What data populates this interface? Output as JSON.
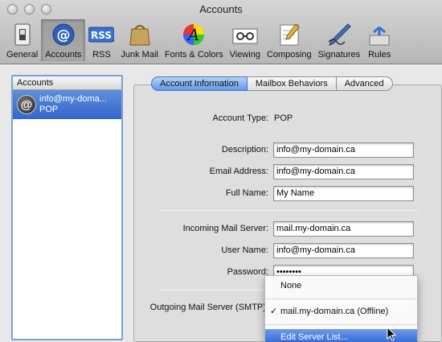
{
  "window": {
    "title": "Accounts"
  },
  "toolbar": {
    "items": [
      {
        "label": "General",
        "icon": "general-switch-icon"
      },
      {
        "label": "Accounts",
        "icon": "at-sign-icon"
      },
      {
        "label": "RSS",
        "icon": "rss-icon"
      },
      {
        "label": "Junk Mail",
        "icon": "junk-mail-bag-icon"
      },
      {
        "label": "Fonts & Colors",
        "icon": "fonts-colors-icon"
      },
      {
        "label": "Viewing",
        "icon": "viewing-icon"
      },
      {
        "label": "Composing",
        "icon": "composing-icon"
      },
      {
        "label": "Signatures",
        "icon": "signature-pen-icon"
      },
      {
        "label": "Rules",
        "icon": "rules-icon"
      }
    ],
    "selected": "Accounts"
  },
  "accounts_list": {
    "header": "Accounts",
    "items": [
      {
        "name": "info@my-doma...",
        "type": "POP"
      }
    ]
  },
  "tabs": [
    {
      "label": "Account Information",
      "selected": true
    },
    {
      "label": "Mailbox Behaviors",
      "selected": false
    },
    {
      "label": "Advanced",
      "selected": false
    }
  ],
  "form": {
    "account_type_label": "Account Type:",
    "account_type_value": "POP",
    "description_label": "Description:",
    "description_value": "info@my-domain.ca",
    "email_label": "Email Address:",
    "email_value": "info@my-domain.ca",
    "fullname_label": "Full Name:",
    "fullname_value": "My Name",
    "incoming_label": "Incoming Mail Server:",
    "incoming_value": "mail.my-domain.ca",
    "username_label": "User Name:",
    "username_value": "info@my-domain.ca",
    "password_label": "Password:",
    "password_value": "••••••••",
    "outgoing_label": "Outgoing Mail Server (SMTP):"
  },
  "smtp_menu": {
    "items": [
      {
        "label": "None",
        "checked": false
      },
      {
        "label": "mail.my-domain.ca (Offline)",
        "checked": true
      },
      {
        "label": "Edit Server List...",
        "highlighted": true
      }
    ],
    "check_glyph": "✓"
  },
  "colors": {
    "selection_blue": "#3366cc",
    "tab_blue": "#5f99e6"
  }
}
